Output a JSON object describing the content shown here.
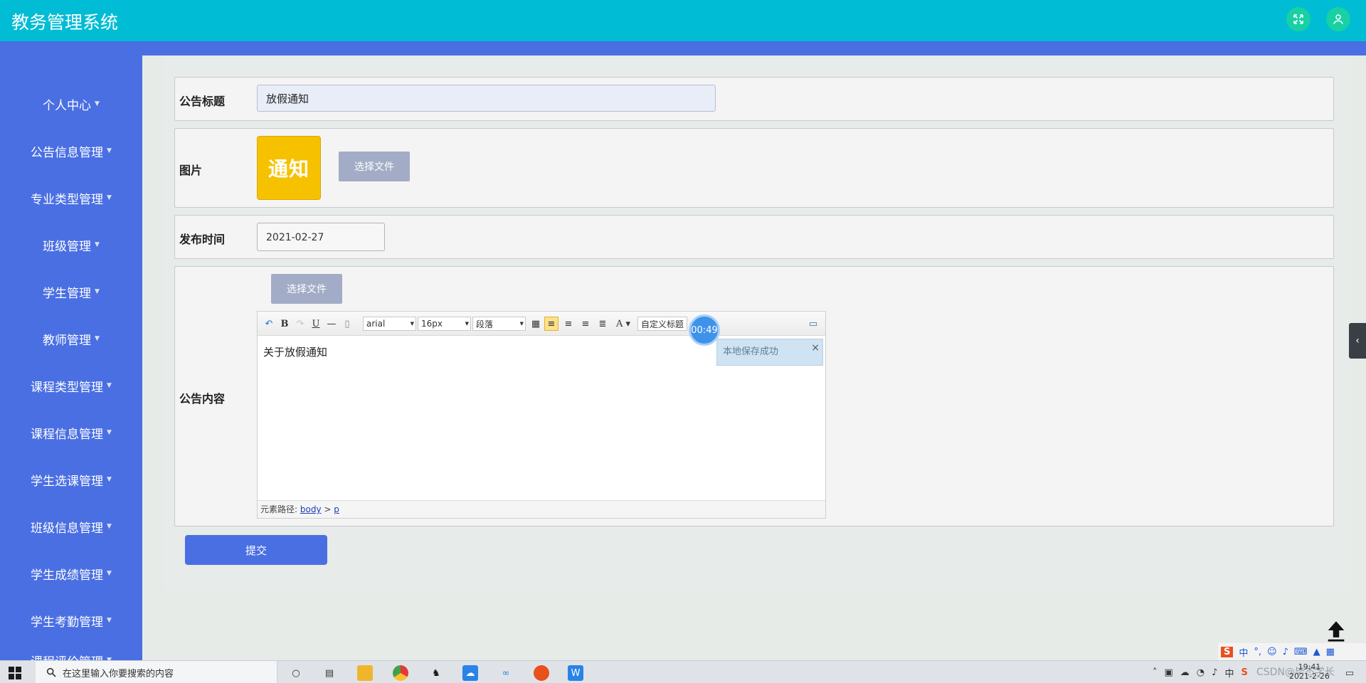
{
  "app": {
    "title": "教务管理系统"
  },
  "sidebar": {
    "items": [
      {
        "label": "个人中心"
      },
      {
        "label": "公告信息管理"
      },
      {
        "label": "专业类型管理"
      },
      {
        "label": "班级管理"
      },
      {
        "label": "学生管理"
      },
      {
        "label": "教师管理"
      },
      {
        "label": "课程类型管理"
      },
      {
        "label": "课程信息管理"
      },
      {
        "label": "学生选课管理"
      },
      {
        "label": "班级信息管理"
      },
      {
        "label": "学生成绩管理"
      },
      {
        "label": "学生考勤管理"
      },
      {
        "label": "课程评价管理"
      }
    ]
  },
  "form": {
    "title_label": "公告标题",
    "title_value": "放假通知",
    "image_label": "图片",
    "image_text": "通知",
    "choose_file_label": "选择文件",
    "date_label": "发布时间",
    "date_value": "2021-02-27",
    "content_label": "公告内容",
    "content_choose_file_label": "选择文件",
    "submit_label": "提交"
  },
  "editor": {
    "font_family": "arial",
    "font_size": "16px",
    "paragraph": "段落",
    "custom_title": "自定义标题",
    "content": "关于放假通知",
    "path_label": "元素路径:",
    "path_body": "body",
    "path_sep": ">",
    "path_p": "p",
    "save_tip": "本地保存成功",
    "timer": "00:49"
  },
  "taskbar": {
    "search_placeholder": "在这里输入你要搜索的内容",
    "ime_lang": "中",
    "watermark": "CSDN@毕杰学长",
    "time": "19:41",
    "date": "2021-2-26"
  },
  "colors": {
    "header": "#00bcd4",
    "sidebar": "#4a6fe3",
    "accent": "#17d1a4",
    "submit": "#4a6fe3"
  }
}
